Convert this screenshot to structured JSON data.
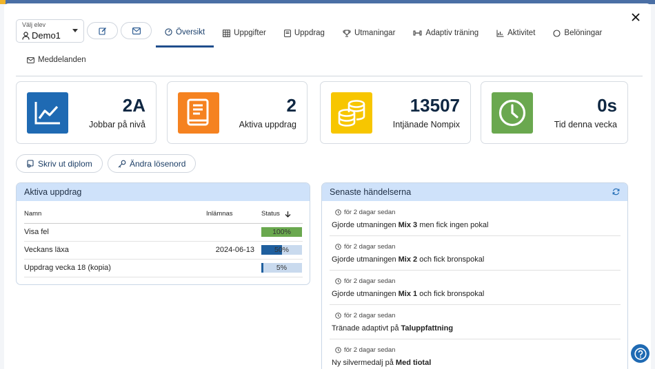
{
  "student_select": {
    "label": "Välj elev",
    "value": "Demo1"
  },
  "tabs": [
    {
      "label": "Översikt",
      "icon": "gauge-icon",
      "active": true
    },
    {
      "label": "Uppgifter",
      "icon": "grid-icon"
    },
    {
      "label": "Uppdrag",
      "icon": "book-icon"
    },
    {
      "label": "Utmaningar",
      "icon": "trophy-icon"
    },
    {
      "label": "Adaptiv träning",
      "icon": "dumbbell-icon"
    },
    {
      "label": "Aktivitet",
      "icon": "chart-icon"
    },
    {
      "label": "Belöningar",
      "icon": "circle-icon"
    }
  ],
  "tab_messages": {
    "label": "Meddelanden",
    "icon": "envelope-icon"
  },
  "stats": [
    {
      "value": "2A",
      "caption": "Jobbar på nivå",
      "icon": "line-chart-icon",
      "color": "#1f6ab3"
    },
    {
      "value": "2",
      "caption": "Aktiva uppdrag",
      "icon": "book-icon",
      "color": "#f58220"
    },
    {
      "value": "13507",
      "caption": "Intjänade Nompix",
      "icon": "coins-icon",
      "color": "#f7c600"
    },
    {
      "value": "0s",
      "caption": "Tid denna vecka",
      "icon": "clock-icon",
      "color": "#6aa84f"
    }
  ],
  "actions": {
    "print_diploma": "Skriv ut diplom",
    "change_password": "Ändra lösenord"
  },
  "active_assignments": {
    "title": "Aktiva uppdrag",
    "columns": {
      "name": "Namn",
      "submitted": "Inlämnas",
      "status": "Status"
    },
    "rows": [
      {
        "name": "Visa fel",
        "submitted": "",
        "status": "100%",
        "progress": 1.0,
        "color": "#6aa84f"
      },
      {
        "name": "Veckans läxa",
        "submitted": "2024-06-13",
        "status": "50%",
        "progress": 0.5,
        "color": "#1f5f9e"
      },
      {
        "name": "Uppdrag vecka 18 (kopia)",
        "submitted": "",
        "status": "5%",
        "progress": 0.05,
        "color": "#1f5f9e"
      }
    ]
  },
  "recent_events": {
    "title": "Senaste händelserna",
    "items": [
      {
        "time": "för 2 dagar sedan",
        "pre": "Gjorde utmaningen ",
        "bold": "Mix 3",
        "post": " men fick ingen pokal"
      },
      {
        "time": "för 2 dagar sedan",
        "pre": "Gjorde utmaningen ",
        "bold": "Mix 2",
        "post": " och fick bronspokal"
      },
      {
        "time": "för 2 dagar sedan",
        "pre": "Gjorde utmaningen ",
        "bold": "Mix 1",
        "post": " och fick bronspokal"
      },
      {
        "time": "för 2 dagar sedan",
        "pre": "Tränade adaptivt på ",
        "bold": "Taluppfattning",
        "post": ""
      },
      {
        "time": "för 2 dagar sedan",
        "pre": "Ny silvermedalj på ",
        "bold": "Med tiotal",
        "post": ""
      }
    ]
  }
}
